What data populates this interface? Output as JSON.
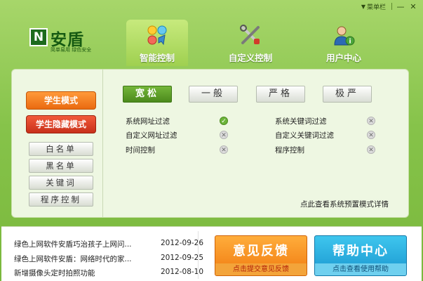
{
  "titlebar": {
    "menu_label": "菜单栏",
    "minimize_glyph": "—",
    "close_glyph": "✕"
  },
  "logo": {
    "letter": "N",
    "name": "安盾",
    "slogan": "简单易用  绿色安全"
  },
  "tabs": [
    {
      "label": "智能控制",
      "icon": "smart-control-icon",
      "active": true
    },
    {
      "label": "自定义控制",
      "icon": "tools-icon",
      "active": false
    },
    {
      "label": "用户中心",
      "icon": "user-icon",
      "active": false
    }
  ],
  "modes": {
    "student": "学生模式",
    "student_hidden": "学生隐藏模式"
  },
  "side_buttons": [
    "白名单",
    "黑名单",
    "关键词",
    "程序控制"
  ],
  "levels": [
    {
      "label": "宽松",
      "active": true
    },
    {
      "label": "一般",
      "active": false
    },
    {
      "label": "严格",
      "active": false
    },
    {
      "label": "极严",
      "active": false
    }
  ],
  "features_left": [
    {
      "label": "系统网址过滤",
      "enabled": true
    },
    {
      "label": "自定义网址过滤",
      "enabled": false
    },
    {
      "label": "时间控制",
      "enabled": false
    }
  ],
  "features_right": [
    {
      "label": "系统关键词过滤",
      "enabled": false
    },
    {
      "label": "自定义关键词过滤",
      "enabled": false
    },
    {
      "label": "程序控制",
      "enabled": false
    }
  ],
  "detail_link": "点此查看系统预置模式详情",
  "news": [
    {
      "title": "绿色上网软件安盾巧治孩子上网问...",
      "date": "2012-09-26"
    },
    {
      "title": "绿色上网软件安盾：网络时代的家...",
      "date": "2012-09-25"
    },
    {
      "title": "新增摄像头定时拍照功能",
      "date": "2012-08-10"
    }
  ],
  "feedback": {
    "title": "意见反馈",
    "subtitle": "点击提交意见反馈"
  },
  "help": {
    "title": "帮助中心",
    "subtitle": "点击查看使用帮助"
  },
  "colors": {
    "accent_green": "#5a9e24",
    "orange": "#f07a10",
    "red": "#c8301a",
    "blue": "#1a96cf"
  }
}
